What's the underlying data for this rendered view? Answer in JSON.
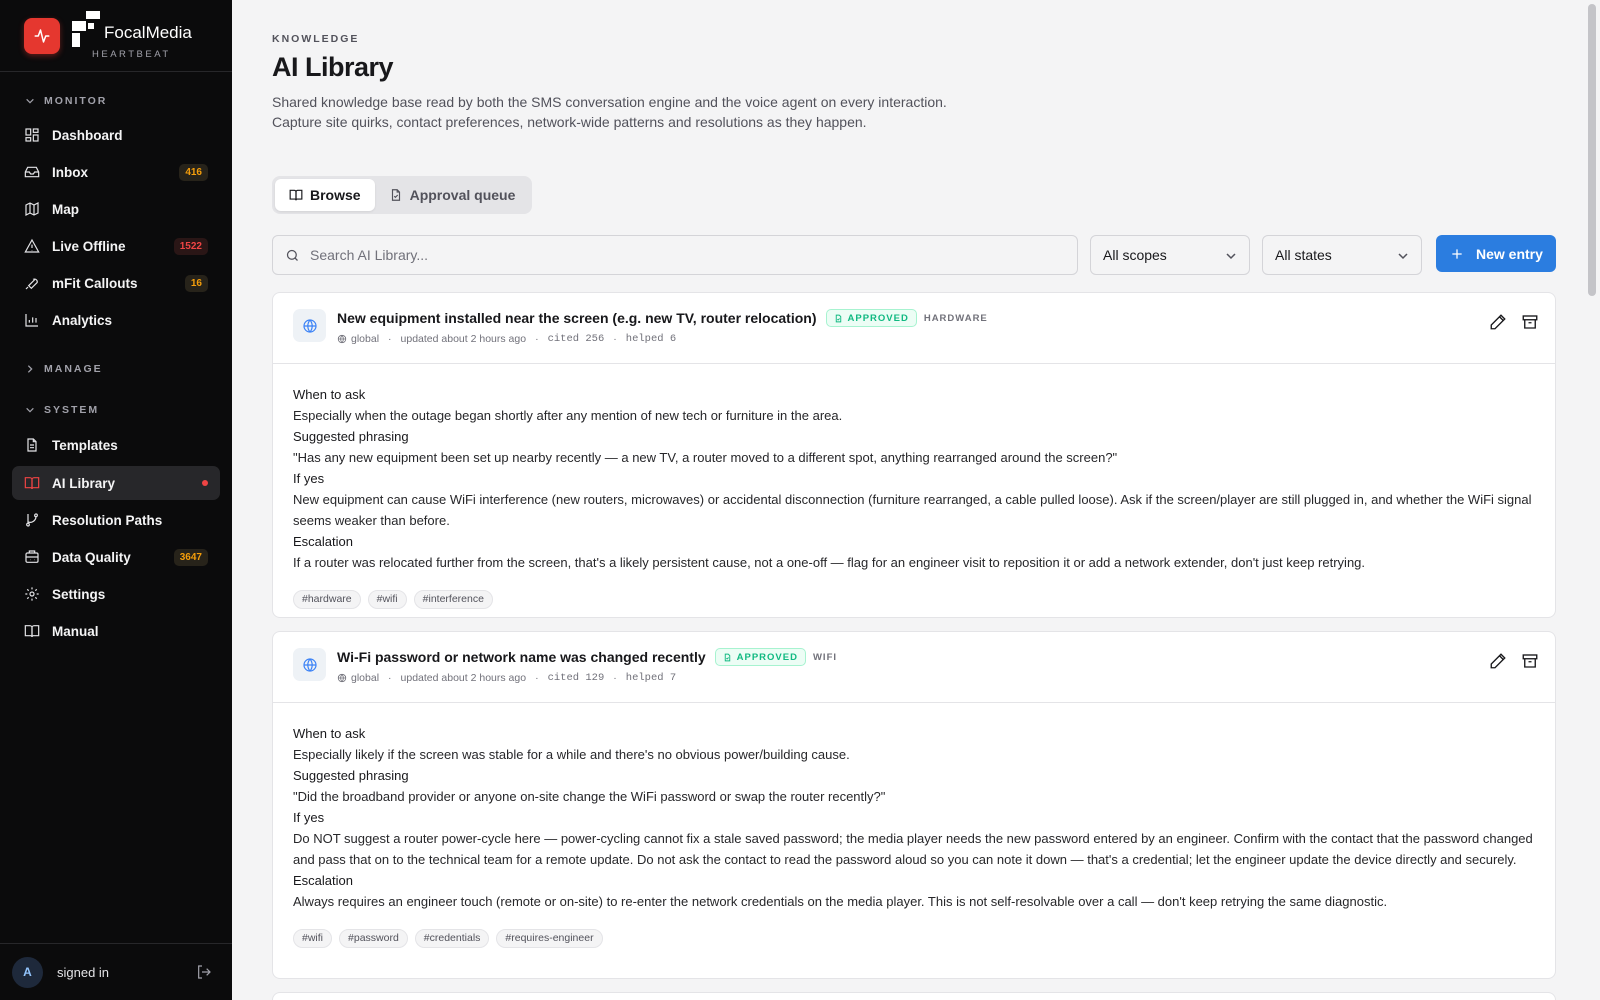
{
  "brand": {
    "name": "FocalMedia",
    "product": "HEARTBEAT",
    "accent": "#e5372f"
  },
  "nav": {
    "monitor_label": "MONITOR",
    "manage_label": "MANAGE",
    "system_label": "SYSTEM",
    "monitor_items": [
      {
        "label": "Dashboard",
        "icon": "dashboard-icon",
        "badge": ""
      },
      {
        "label": "Inbox",
        "icon": "inbox-icon",
        "badge": "416"
      },
      {
        "label": "Map",
        "icon": "map-icon",
        "badge": ""
      },
      {
        "label": "Live Offline",
        "icon": "alert-triangle-icon",
        "badge": "1522"
      },
      {
        "label": "mFit Callouts",
        "icon": "wrench-icon",
        "badge": "16"
      },
      {
        "label": "Analytics",
        "icon": "bar-chart-icon",
        "badge": ""
      }
    ],
    "system_items": [
      {
        "label": "Templates",
        "icon": "file-text-icon"
      },
      {
        "label": "AI Library",
        "icon": "book-open-icon",
        "active": true
      },
      {
        "label": "Resolution Paths",
        "icon": "git-branch-icon"
      },
      {
        "label": "Data Quality",
        "icon": "database-icon",
        "badge": "3647"
      },
      {
        "label": "Settings",
        "icon": "gear-icon"
      },
      {
        "label": "Manual",
        "icon": "book-icon"
      }
    ]
  },
  "user": {
    "avatar": "A",
    "label": "signed in"
  },
  "page": {
    "eyebrow": "KNOWLEDGE",
    "title": "AI Library",
    "description": "Shared knowledge base read by both the SMS conversation engine and the voice agent on every interaction. Capture site quirks, contact preferences, network-wide patterns and resolutions as they happen."
  },
  "tabs": [
    {
      "label": "Browse",
      "active": true
    },
    {
      "label": "Approval queue",
      "active": false
    }
  ],
  "toolbar": {
    "search_placeholder": "Search AI Library...",
    "scope_select": "All scopes",
    "state_select": "All states",
    "new_button": "New entry"
  },
  "entries": [
    {
      "title": "New equipment installed near the screen (e.g. new TV, router relocation)",
      "status": "APPROVED",
      "category": "HARDWARE",
      "scope": "global",
      "updated": "updated about 2 hours ago",
      "cited": "cited 256",
      "helped": "helped 6",
      "lines": [
        {
          "text": "When to ask",
          "heading": true
        },
        {
          "text": "Especially when the outage began shortly after any mention of new tech or furniture in the area."
        },
        {
          "text": "Suggested phrasing",
          "heading": true
        },
        {
          "text": "\"Has any new equipment been set up nearby recently — a new TV, a router moved to a different spot, anything rearranged around the screen?\""
        },
        {
          "text": "If yes",
          "heading": true
        },
        {
          "text": "New equipment can cause WiFi interference (new routers, microwaves) or accidental disconnection (furniture rearranged, a cable pulled loose). Ask if the screen/player are still plugged in, and whether the WiFi signal seems weaker than before."
        },
        {
          "text": "Escalation",
          "heading": true
        },
        {
          "text": "If a router was relocated further from the screen, that's a likely persistent cause, not a one-off — flag for an engineer visit to reposition it or add a network extender, don't just keep retrying."
        }
      ],
      "tags": [
        "#hardware",
        "#wifi",
        "#interference"
      ]
    },
    {
      "title": "Wi-Fi password or network name was changed recently",
      "status": "APPROVED",
      "category": "WIFI",
      "scope": "global",
      "updated": "updated about 2 hours ago",
      "cited": "cited 129",
      "helped": "helped 7",
      "lines": [
        {
          "text": "When to ask",
          "heading": true
        },
        {
          "text": "Especially likely if the screen was stable for a while and there's no obvious power/building cause."
        },
        {
          "text": "Suggested phrasing",
          "heading": true
        },
        {
          "text": "\"Did the broadband provider or anyone on-site change the WiFi password or swap the router recently?\""
        },
        {
          "text": "If yes",
          "heading": true
        },
        {
          "text": "Do NOT suggest a router power-cycle here — power-cycling cannot fix a stale saved password; the media player needs the new password entered by an engineer. Confirm with the contact that the password changed and pass that on to the technical team for a remote update. Do not ask the contact to read the password aloud so you can note it down — that's a credential; let the engineer update the device directly and securely."
        },
        {
          "text": "Escalation",
          "heading": true
        },
        {
          "text": "Always requires an engineer touch (remote or on-site) to re-enter the network credentials on the media player. This is not self-resolvable over a call — don't keep retrying the same diagnostic."
        }
      ],
      "tags": [
        "#wifi",
        "#password",
        "#credentials",
        "#requires-engineer"
      ]
    }
  ]
}
